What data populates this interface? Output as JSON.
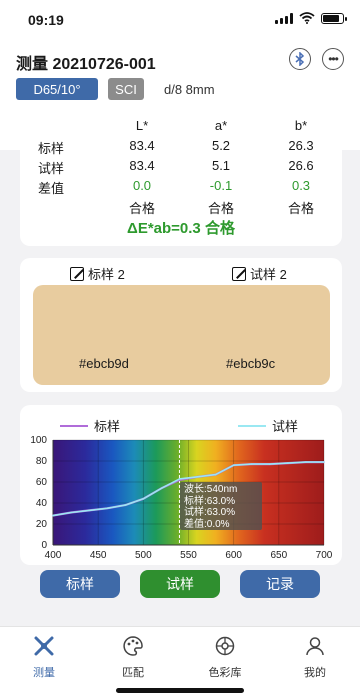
{
  "status": {
    "time": "09:19",
    "battery_level": 0.85
  },
  "header": {
    "title": "测量 20210726-001",
    "illuminant": "D65/10°",
    "mode": "SCI",
    "geometry": "d/8  8mm",
    "bluetooth_icon": "bluetooth-icon",
    "more_icon": "more-icon"
  },
  "lab": {
    "headers": [
      "L*",
      "a*",
      "b*"
    ],
    "rows": [
      {
        "label": "标样",
        "values": [
          "83.4",
          "5.2",
          "26.3"
        ]
      },
      {
        "label": "试样",
        "values": [
          "83.4",
          "5.1",
          "26.6"
        ]
      },
      {
        "label": "差值",
        "values": [
          "0.0",
          "-0.1",
          "0.3"
        ]
      },
      {
        "label": "",
        "values": [
          "合格",
          "合格",
          "合格"
        ]
      }
    ],
    "delta_e": "ΔE*ab=0.3  合格",
    "pass_color": "#2e9a2e"
  },
  "swatch": {
    "standard_label": "标样 2",
    "sample_label": "试样 2",
    "standard_hex": "#ebcb9d",
    "sample_hex": "#ebcb9c",
    "color": "#e8cc9f"
  },
  "chart_data": {
    "type": "line",
    "xlim": [
      400,
      700
    ],
    "ylim": [
      0,
      100
    ],
    "x_ticks": [
      400,
      450,
      500,
      550,
      600,
      650,
      700
    ],
    "y_ticks": [
      0,
      20,
      40,
      60,
      80,
      100
    ],
    "series": [
      {
        "name": "标样",
        "color": "#b06cd9",
        "x": [
          400,
          420,
          440,
          460,
          480,
          500,
          520,
          540,
          560,
          580,
          600,
          620,
          640,
          660,
          680,
          700
        ],
        "y": [
          28,
          31,
          33,
          35,
          38,
          44,
          54,
          62,
          65,
          67,
          76,
          77,
          77,
          78,
          79,
          79
        ]
      },
      {
        "name": "试样",
        "color": "#9ae8f2",
        "x": [
          400,
          420,
          440,
          460,
          480,
          500,
          520,
          540,
          560,
          580,
          600,
          620,
          640,
          660,
          680,
          700
        ],
        "y": [
          28,
          31,
          33,
          35,
          38,
          44,
          54,
          63,
          65,
          67,
          76,
          77,
          77,
          78,
          79,
          79
        ]
      }
    ],
    "cursor_x": 540,
    "tooltip": [
      "波长:540nm",
      "标样:63.0%",
      "试样:63.0%",
      "差值:0.0%"
    ]
  },
  "actions": [
    {
      "label": "标样",
      "color": "#3f6aa8"
    },
    {
      "label": "试样",
      "color": "#2f8f2f"
    },
    {
      "label": "记录",
      "color": "#3f6aa8"
    }
  ],
  "tabs": [
    {
      "label": "测量",
      "icon": "measure-icon",
      "color": "#3f6aa8"
    },
    {
      "label": "匹配",
      "icon": "palette-icon",
      "color": "#444444"
    },
    {
      "label": "色彩库",
      "icon": "color-library-icon",
      "color": "#444444"
    },
    {
      "label": "我的",
      "icon": "profile-icon",
      "color": "#444444"
    }
  ]
}
